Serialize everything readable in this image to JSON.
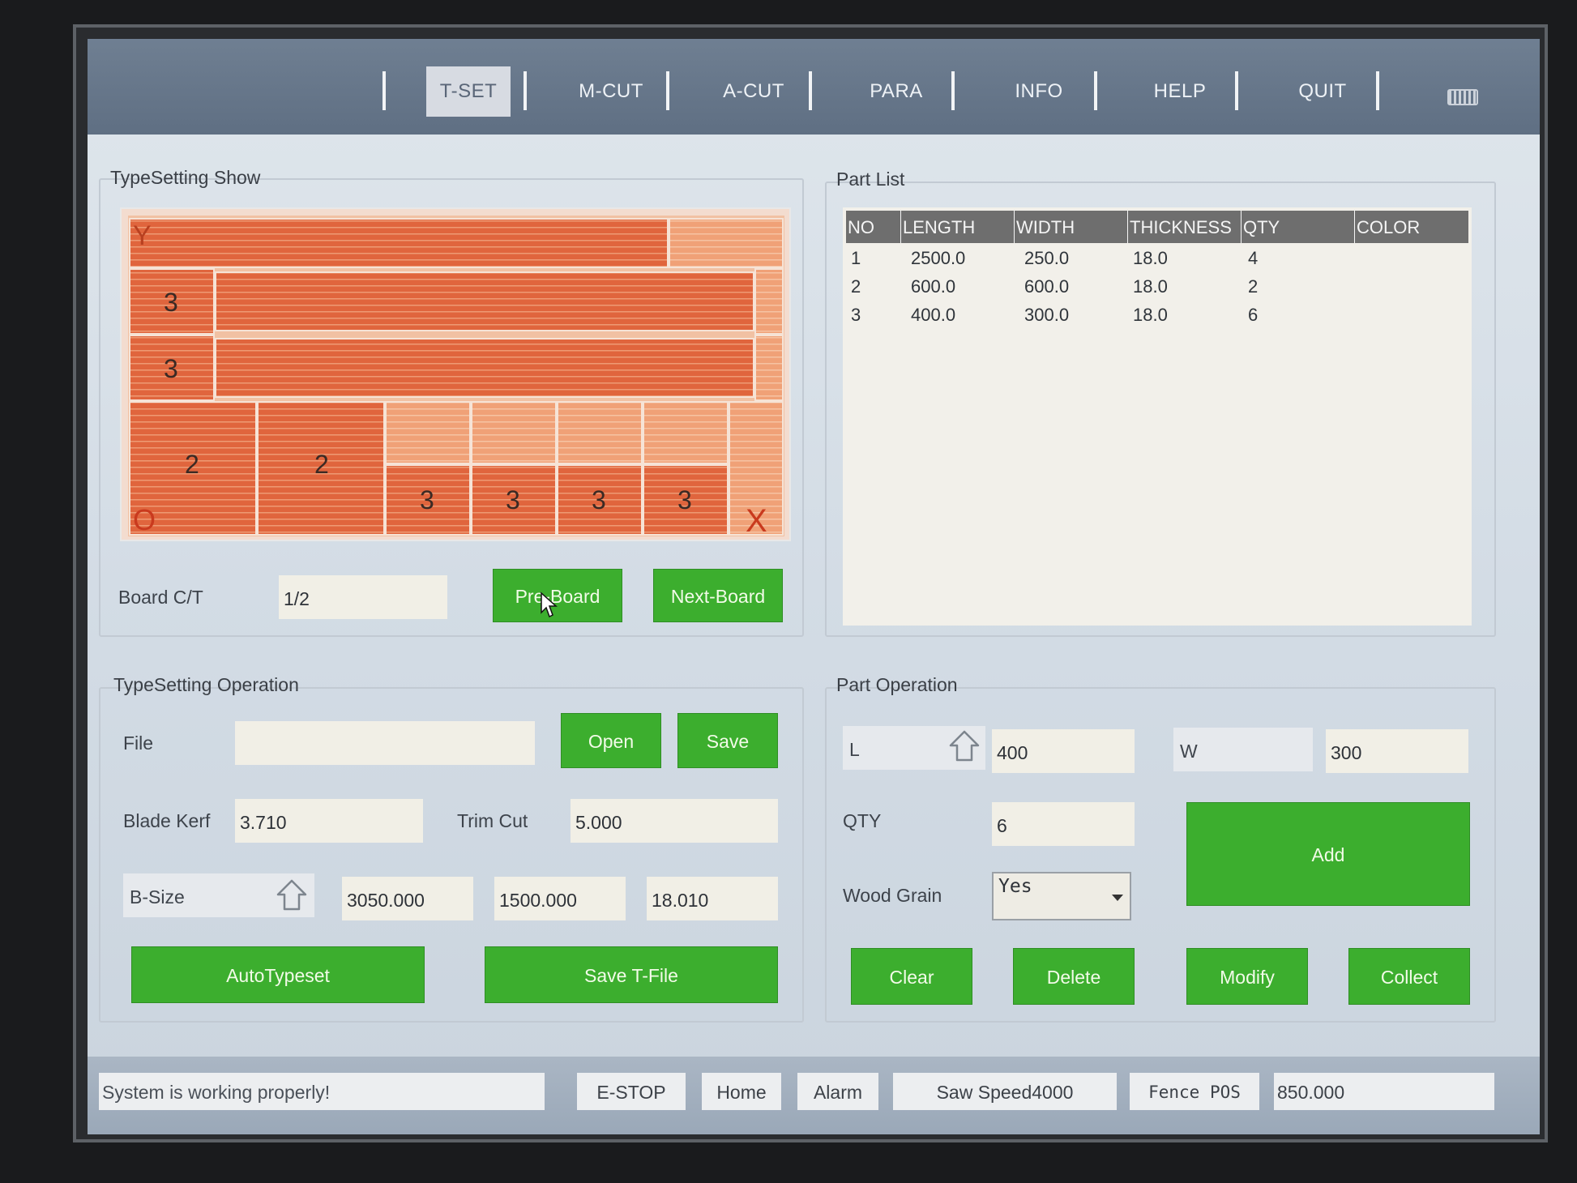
{
  "menu": {
    "items": [
      "T-SET",
      "M-CUT",
      "A-CUT",
      "PARA",
      "INFO",
      "HELP",
      "QUIT"
    ],
    "active": "T-SET"
  },
  "typesetting_show": {
    "title": "TypeSetting Show",
    "board_labels": {
      "corner_y": "Y",
      "corner_o": "O",
      "corner_x": "X",
      "parts": [
        "3",
        "3",
        "2",
        "2",
        "3",
        "3",
        "3",
        "3"
      ]
    },
    "board_ct_label": "Board C/T",
    "board_ct_value": "1/2",
    "pre_board_label": "Pre-Board",
    "next_board_label": "Next-Board"
  },
  "part_list": {
    "title": "Part List",
    "columns": [
      "NO",
      "LENGTH",
      "WIDTH",
      "THICKNESS",
      "QTY",
      "COLOR"
    ],
    "rows": [
      [
        "1",
        "2500.0",
        "250.0",
        "18.0",
        "4",
        ""
      ],
      [
        "2",
        "600.0",
        "600.0",
        "18.0",
        "2",
        ""
      ],
      [
        "3",
        "400.0",
        "300.0",
        "18.0",
        "6",
        ""
      ]
    ]
  },
  "typesetting_operation": {
    "title": "TypeSetting Operation",
    "file_label": "File",
    "file_value": "",
    "open_label": "Open",
    "save_label": "Save",
    "blade_kerf_label": "Blade Kerf",
    "blade_kerf_value": "3.710",
    "trim_cut_label": "Trim Cut",
    "trim_cut_value": "5.000",
    "bsize_label": "B-Size",
    "bsize_length": "3050.000",
    "bsize_width": "1500.000",
    "bsize_thickness": "18.010",
    "autotypeset_label": "AutoTypeset",
    "save_tfile_label": "Save T-File"
  },
  "part_operation": {
    "title": "Part Operation",
    "l_label": "L",
    "l_value": "400",
    "w_label": "W",
    "w_value": "300",
    "qty_label": "QTY",
    "qty_value": "6",
    "wood_grain_label": "Wood Grain",
    "wood_grain_value": "Yes",
    "add_label": "Add",
    "clear_label": "Clear",
    "delete_label": "Delete",
    "modify_label": "Modify",
    "collect_label": "Collect"
  },
  "status": {
    "message": "System is working properly!",
    "estop_label": "E-STOP",
    "home_label": "Home",
    "alarm_label": "Alarm",
    "saw_speed_label": "Saw Speed4000",
    "fence_pos_label": "Fence  POS",
    "fence_pos_value": "850.000"
  },
  "colors": {
    "menubar": "#667789",
    "accent_green": "#3cae2e",
    "board_part_dark": "#e0613a",
    "board_part_light": "#ef9566",
    "table_header": "#6e6e6e"
  }
}
